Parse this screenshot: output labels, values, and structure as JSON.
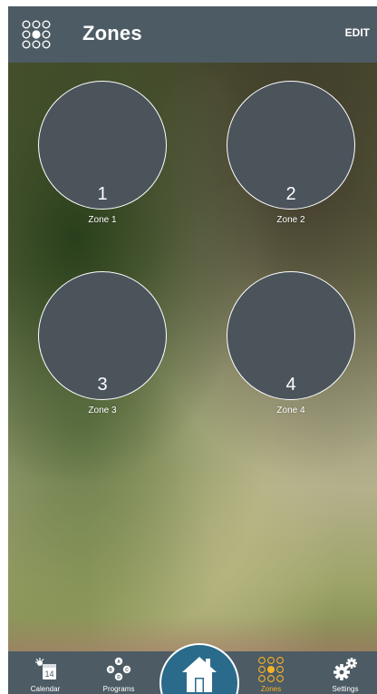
{
  "header": {
    "title": "Zones",
    "edit_label": "EDIT",
    "menu_icon": "grid-dots-icon"
  },
  "zones": [
    {
      "number": "1",
      "label": "Zone 1"
    },
    {
      "number": "2",
      "label": "Zone 2"
    },
    {
      "number": "3",
      "label": "Zone 3"
    },
    {
      "number": "4",
      "label": "Zone 4"
    }
  ],
  "navbar": {
    "items": [
      {
        "label": "Calendar",
        "icon": "calendar-icon",
        "badge": "14"
      },
      {
        "label": "Programs",
        "icon": "programs-icon",
        "badges": [
          "A",
          "B",
          "C",
          "D"
        ]
      },
      {
        "label": "Zones",
        "icon": "zones-grid-icon",
        "active": true
      },
      {
        "label": "Settings",
        "icon": "gear-icon"
      }
    ],
    "home_icon": "home-icon"
  },
  "colors": {
    "header_bg": "#4d5b64",
    "zone_fill": "#4b535b",
    "home_button": "#2a6b8c",
    "active_accent": "#f5b324"
  }
}
